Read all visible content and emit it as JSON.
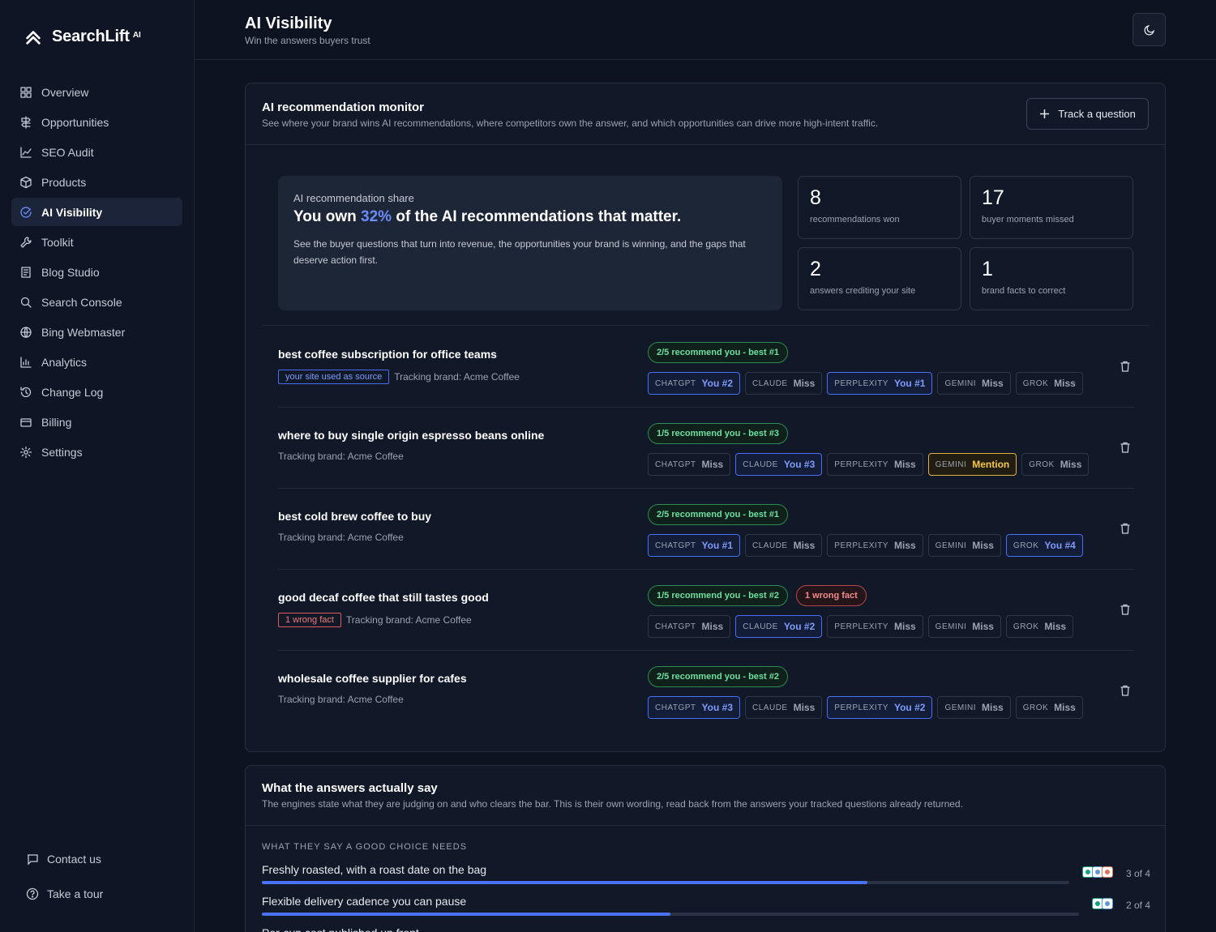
{
  "brand": {
    "name": "SearchLift",
    "suffix": "AI"
  },
  "nav": [
    {
      "label": "Overview",
      "icon": "grid-icon"
    },
    {
      "label": "Opportunities",
      "icon": "signpost-icon"
    },
    {
      "label": "SEO Audit",
      "icon": "chart-line-icon"
    },
    {
      "label": "Products",
      "icon": "box-icon"
    },
    {
      "label": "AI Visibility",
      "icon": "check-circle-icon",
      "active": true
    },
    {
      "label": "Toolkit",
      "icon": "wrench-icon"
    },
    {
      "label": "Blog Studio",
      "icon": "document-icon"
    },
    {
      "label": "Search Console",
      "icon": "search-icon"
    },
    {
      "label": "Bing Webmaster",
      "icon": "globe-icon"
    },
    {
      "label": "Analytics",
      "icon": "bar-chart-icon"
    },
    {
      "label": "Change Log",
      "icon": "history-icon"
    },
    {
      "label": "Billing",
      "icon": "card-icon"
    },
    {
      "label": "Settings",
      "icon": "gear-icon"
    }
  ],
  "nav_bottom": {
    "contact": "Contact us",
    "tour": "Take a tour"
  },
  "header": {
    "title": "AI Visibility",
    "subtitle": "Win the answers buyers trust"
  },
  "monitor": {
    "title": "AI recommendation monitor",
    "description": "See where your brand wins AI recommendations, where competitors own the answer, and which opportunities can drive more high-intent traffic.",
    "track_button": "Track a question",
    "hero": {
      "label": "AI recommendation share",
      "headline_pre": "You own ",
      "headline_value": "32%",
      "headline_post": " of the AI recommendations that matter.",
      "body": "See the buyer questions that turn into revenue, the opportunities your brand is winning, and the gaps that deserve action first."
    },
    "stats": [
      {
        "value": "8",
        "label": "recommendations won"
      },
      {
        "value": "17",
        "label": "buyer moments missed"
      },
      {
        "value": "2",
        "label": "answers crediting your site"
      },
      {
        "value": "1",
        "label": "brand facts to correct"
      }
    ],
    "questions": [
      {
        "title": "best coffee subscription for office teams",
        "tag_source": "your site used as source",
        "tracking": "Tracking brand: Acme Coffee",
        "summary": "2/5 recommend you - best #1",
        "engines": [
          {
            "name": "CHATGPT",
            "result": "You #2",
            "state": "you"
          },
          {
            "name": "CLAUDE",
            "result": "Miss",
            "state": "miss"
          },
          {
            "name": "PERPLEXITY",
            "result": "You #1",
            "state": "you"
          },
          {
            "name": "GEMINI",
            "result": "Miss",
            "state": "miss"
          },
          {
            "name": "GROK",
            "result": "Miss",
            "state": "miss"
          }
        ]
      },
      {
        "title": "where to buy single origin espresso beans online",
        "tracking": "Tracking brand: Acme Coffee",
        "summary": "1/5 recommend you - best #3",
        "engines": [
          {
            "name": "CHATGPT",
            "result": "Miss",
            "state": "miss"
          },
          {
            "name": "CLAUDE",
            "result": "You #3",
            "state": "you"
          },
          {
            "name": "PERPLEXITY",
            "result": "Miss",
            "state": "miss"
          },
          {
            "name": "GEMINI",
            "result": "Mention",
            "state": "mention"
          },
          {
            "name": "GROK",
            "result": "Miss",
            "state": "miss"
          }
        ]
      },
      {
        "title": "best cold brew coffee to buy",
        "tracking": "Tracking brand: Acme Coffee",
        "summary": "2/5 recommend you - best #1",
        "engines": [
          {
            "name": "CHATGPT",
            "result": "You #1",
            "state": "you"
          },
          {
            "name": "CLAUDE",
            "result": "Miss",
            "state": "miss"
          },
          {
            "name": "PERPLEXITY",
            "result": "Miss",
            "state": "miss"
          },
          {
            "name": "GEMINI",
            "result": "Miss",
            "state": "miss"
          },
          {
            "name": "GROK",
            "result": "You #4",
            "state": "you"
          }
        ]
      },
      {
        "title": "good decaf coffee that still tastes good",
        "tag_wrong": "1 wrong fact",
        "tracking": "Tracking brand: Acme Coffee",
        "summary": "1/5 recommend you - best #2",
        "alert": "1 wrong fact",
        "engines": [
          {
            "name": "CHATGPT",
            "result": "Miss",
            "state": "miss"
          },
          {
            "name": "CLAUDE",
            "result": "You #2",
            "state": "you"
          },
          {
            "name": "PERPLEXITY",
            "result": "Miss",
            "state": "miss"
          },
          {
            "name": "GEMINI",
            "result": "Miss",
            "state": "miss"
          },
          {
            "name": "GROK",
            "result": "Miss",
            "state": "miss"
          }
        ]
      },
      {
        "title": "wholesale coffee supplier for cafes",
        "tracking": "Tracking brand: Acme Coffee",
        "summary": "2/5 recommend you - best #2",
        "engines": [
          {
            "name": "CHATGPT",
            "result": "You #3",
            "state": "you"
          },
          {
            "name": "CLAUDE",
            "result": "Miss",
            "state": "miss"
          },
          {
            "name": "PERPLEXITY",
            "result": "You #2",
            "state": "you"
          },
          {
            "name": "GEMINI",
            "result": "Miss",
            "state": "miss"
          },
          {
            "name": "GROK",
            "result": "Miss",
            "state": "miss"
          }
        ]
      }
    ]
  },
  "answers": {
    "title": "What the answers actually say",
    "description": "The engines state what they are judging on and who clears the bar. This is their own wording, read back from the answers your tracked questions already returned.",
    "section_label": "WHAT THEY SAY A GOOD CHOICE NEEDS",
    "criteria": [
      {
        "label": "Freshly roasted, with a roast date on the bag",
        "count": "3 of 4",
        "fraction": 0.75,
        "icons": 3
      },
      {
        "label": "Flexible delivery cadence you can pause",
        "count": "2 of 4",
        "fraction": 0.5,
        "icons": 2
      },
      {
        "label": "Per-cup cost published up front",
        "count": "",
        "fraction": 0.5,
        "icons": 0
      }
    ]
  }
}
